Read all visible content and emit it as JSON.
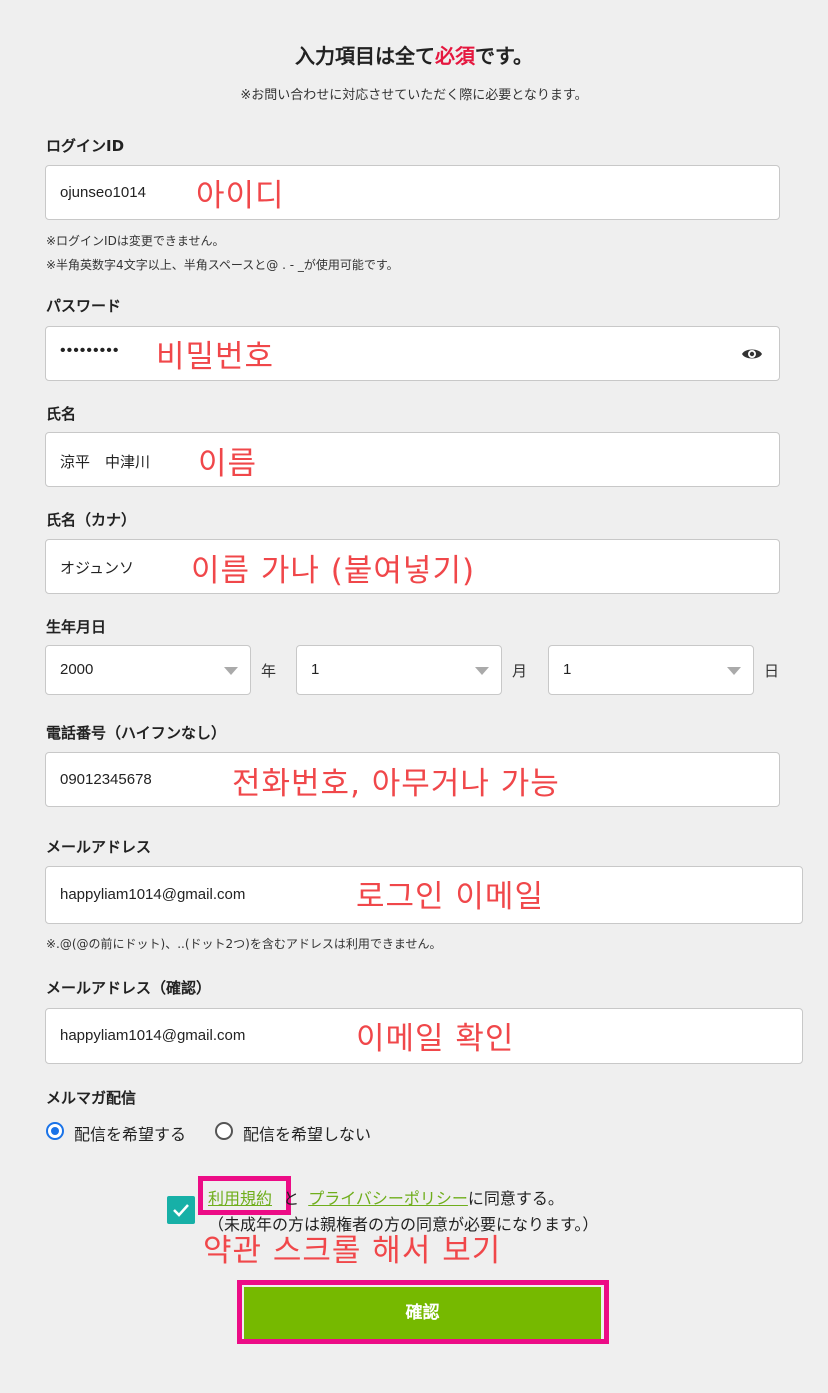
{
  "header": {
    "title_before": "入力項目は全て",
    "title_required": "必須",
    "title_after": "です。",
    "subtitle": "※お問い合わせに対応させていただく際に必要となります。"
  },
  "login_id": {
    "label": "ログインID",
    "value": "ojunseo1014",
    "annotation": "아이디",
    "note1": "※ログインIDは変更できません。",
    "note2": "※半角英数字4文字以上、半角スペースと@ . - _が使用可能です。"
  },
  "password": {
    "label": "パスワード",
    "value": "•••••••••",
    "annotation": "비밀번호"
  },
  "name": {
    "label": "氏名",
    "value": "涼平　中津川",
    "annotation": "이름"
  },
  "name_kana": {
    "label": "氏名（カナ）",
    "value": "オジュンソ",
    "annotation": "이름 가나 (붙여넣기)"
  },
  "birthday": {
    "label": "生年月日",
    "year": "2000",
    "year_unit": "年",
    "month": "1",
    "month_unit": "月",
    "day": "1",
    "day_unit": "日"
  },
  "phone": {
    "label": "電話番号（ハイフンなし）",
    "value": "09012345678",
    "annotation": "전화번호, 아무거나 가능"
  },
  "email": {
    "label": "メールアドレス",
    "value": "happyliam1014@gmail.com",
    "annotation": "로그인 이메일",
    "note": "※.@(@の前にドット)、..(ドット2つ)を含むアドレスは利用できません。"
  },
  "email_confirm": {
    "label": "メールアドレス（確認）",
    "value": "happyliam1014@gmail.com",
    "annotation": "이메일 확인"
  },
  "newsletter": {
    "label": "メルマガ配信",
    "option_yes": "配信を希望する",
    "option_no": "配信を希望しない"
  },
  "agreement": {
    "terms_link": "利用規約",
    "and": "と",
    "privacy_link": "プライバシーポリシー",
    "agree_text": "に同意する。",
    "minor_note": "（未成年の方は親権者の方の同意が必要になります。）",
    "annotation": "약관 스크롤 해서 보기"
  },
  "submit": {
    "label": "確認"
  },
  "colors": {
    "accent_green": "#76b900",
    "required_red": "#e5173f",
    "highlight_pink": "#ec0c86",
    "annotation_red": "#f0474a",
    "checkbox_teal": "#17b0a7"
  }
}
